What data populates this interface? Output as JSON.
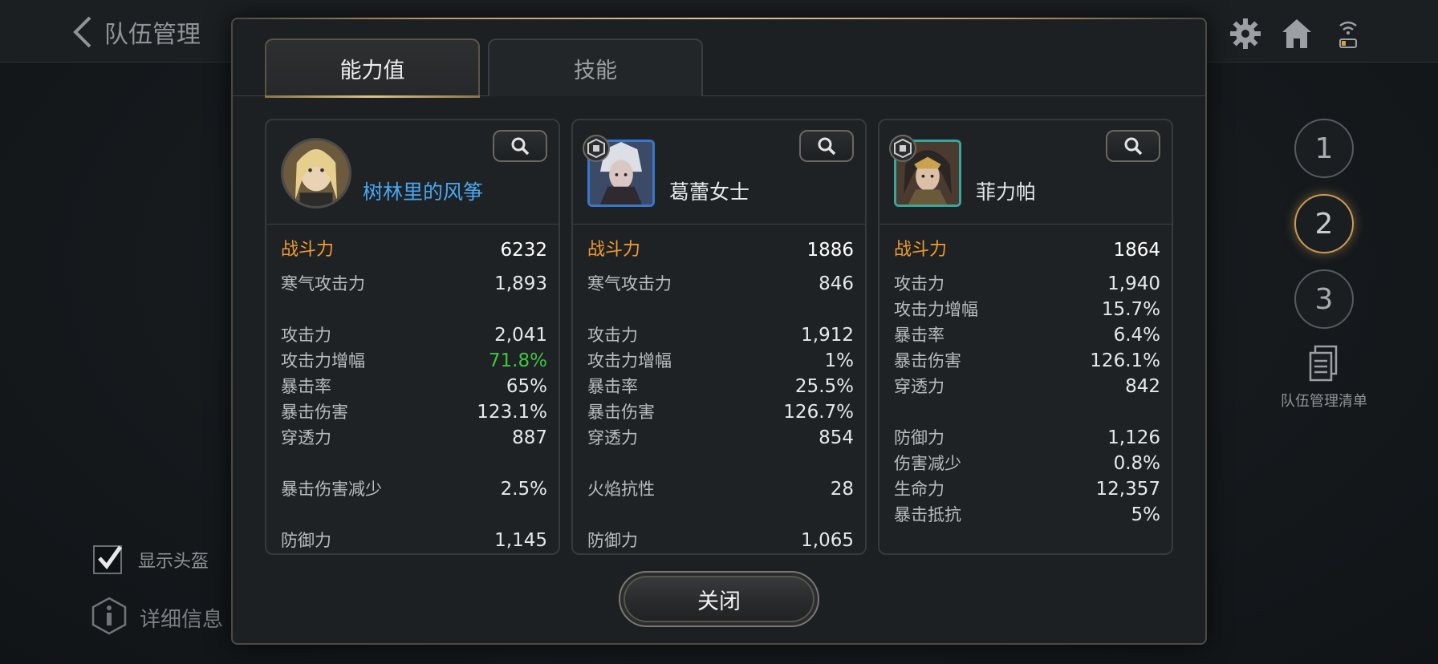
{
  "header": {
    "title": "队伍管理"
  },
  "team_slots": [
    "1",
    "2",
    "3"
  ],
  "team_list": {
    "label": "队伍管理清单"
  },
  "options": {
    "show_helmet": "显示头盔",
    "detail_info": "详细信息"
  },
  "modal": {
    "tabs": [
      "能力值",
      "技能"
    ],
    "close_label": "关闭",
    "heroes": [
      {
        "name": "树林里的风筝",
        "stats": [
          {
            "label": "战斗力",
            "value": "6232"
          },
          {
            "label": "寒气攻击力",
            "value": "1,893"
          },
          {
            "label": "攻击力",
            "value": "2,041"
          },
          {
            "label": "攻击力增幅",
            "value": "71.8%"
          },
          {
            "label": "暴击率",
            "value": "65%"
          },
          {
            "label": "暴击伤害",
            "value": "123.1%"
          },
          {
            "label": "穿透力",
            "value": "887"
          },
          {
            "label": "暴击伤害减少",
            "value": "2.5%"
          },
          {
            "label": "防御力",
            "value": "1,145"
          }
        ]
      },
      {
        "name": "葛蕾女士",
        "stats": [
          {
            "label": "战斗力",
            "value": "1886"
          },
          {
            "label": "寒气攻击力",
            "value": "846"
          },
          {
            "label": "攻击力",
            "value": "1,912"
          },
          {
            "label": "攻击力增幅",
            "value": "1%"
          },
          {
            "label": "暴击率",
            "value": "25.5%"
          },
          {
            "label": "暴击伤害",
            "value": "126.7%"
          },
          {
            "label": "穿透力",
            "value": "854"
          },
          {
            "label": "火焰抗性",
            "value": "28"
          },
          {
            "label": "防御力",
            "value": "1,065"
          }
        ]
      },
      {
        "name": "菲力帕",
        "stats": [
          {
            "label": "战斗力",
            "value": "1864"
          },
          {
            "label": "攻击力",
            "value": "1,940"
          },
          {
            "label": "攻击力增幅",
            "value": "15.7%"
          },
          {
            "label": "暴击率",
            "value": "6.4%"
          },
          {
            "label": "暴击伤害",
            "value": "126.1%"
          },
          {
            "label": "穿透力",
            "value": "842"
          },
          {
            "label": "防御力",
            "value": "1,126"
          },
          {
            "label": "伤害减少",
            "value": "0.8%"
          },
          {
            "label": "生命力",
            "value": "12,357"
          },
          {
            "label": "暴击抵抗",
            "value": "5%"
          }
        ]
      }
    ]
  },
  "icons": [
    "back-arrow-icon",
    "chat-icon",
    "gear-icon",
    "home-icon",
    "wifi-icon",
    "battery-icon",
    "magnifier-icon",
    "rank-badge-icon",
    "document-list-icon",
    "info-icon",
    "checkmark-icon"
  ],
  "colors": {
    "accent_gold": "#c89b55",
    "combat_power": "#f29a33",
    "positive_green": "#40c53f",
    "player_name_blue": "#4aa6ef"
  }
}
